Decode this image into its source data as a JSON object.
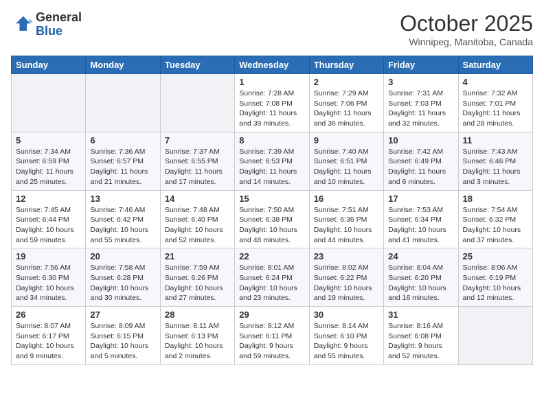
{
  "header": {
    "logo_general": "General",
    "logo_blue": "Blue",
    "month": "October 2025",
    "location": "Winnipeg, Manitoba, Canada"
  },
  "weekdays": [
    "Sunday",
    "Monday",
    "Tuesday",
    "Wednesday",
    "Thursday",
    "Friday",
    "Saturday"
  ],
  "weeks": [
    [
      {
        "day": "",
        "info": ""
      },
      {
        "day": "",
        "info": ""
      },
      {
        "day": "",
        "info": ""
      },
      {
        "day": "1",
        "info": "Sunrise: 7:28 AM\nSunset: 7:08 PM\nDaylight: 11 hours\nand 39 minutes."
      },
      {
        "day": "2",
        "info": "Sunrise: 7:29 AM\nSunset: 7:06 PM\nDaylight: 11 hours\nand 36 minutes."
      },
      {
        "day": "3",
        "info": "Sunrise: 7:31 AM\nSunset: 7:03 PM\nDaylight: 11 hours\nand 32 minutes."
      },
      {
        "day": "4",
        "info": "Sunrise: 7:32 AM\nSunset: 7:01 PM\nDaylight: 11 hours\nand 28 minutes."
      }
    ],
    [
      {
        "day": "5",
        "info": "Sunrise: 7:34 AM\nSunset: 6:59 PM\nDaylight: 11 hours\nand 25 minutes."
      },
      {
        "day": "6",
        "info": "Sunrise: 7:36 AM\nSunset: 6:57 PM\nDaylight: 11 hours\nand 21 minutes."
      },
      {
        "day": "7",
        "info": "Sunrise: 7:37 AM\nSunset: 6:55 PM\nDaylight: 11 hours\nand 17 minutes."
      },
      {
        "day": "8",
        "info": "Sunrise: 7:39 AM\nSunset: 6:53 PM\nDaylight: 11 hours\nand 14 minutes."
      },
      {
        "day": "9",
        "info": "Sunrise: 7:40 AM\nSunset: 6:51 PM\nDaylight: 11 hours\nand 10 minutes."
      },
      {
        "day": "10",
        "info": "Sunrise: 7:42 AM\nSunset: 6:49 PM\nDaylight: 11 hours\nand 6 minutes."
      },
      {
        "day": "11",
        "info": "Sunrise: 7:43 AM\nSunset: 6:46 PM\nDaylight: 11 hours\nand 3 minutes."
      }
    ],
    [
      {
        "day": "12",
        "info": "Sunrise: 7:45 AM\nSunset: 6:44 PM\nDaylight: 10 hours\nand 59 minutes."
      },
      {
        "day": "13",
        "info": "Sunrise: 7:46 AM\nSunset: 6:42 PM\nDaylight: 10 hours\nand 55 minutes."
      },
      {
        "day": "14",
        "info": "Sunrise: 7:48 AM\nSunset: 6:40 PM\nDaylight: 10 hours\nand 52 minutes."
      },
      {
        "day": "15",
        "info": "Sunrise: 7:50 AM\nSunset: 6:38 PM\nDaylight: 10 hours\nand 48 minutes."
      },
      {
        "day": "16",
        "info": "Sunrise: 7:51 AM\nSunset: 6:36 PM\nDaylight: 10 hours\nand 44 minutes."
      },
      {
        "day": "17",
        "info": "Sunrise: 7:53 AM\nSunset: 6:34 PM\nDaylight: 10 hours\nand 41 minutes."
      },
      {
        "day": "18",
        "info": "Sunrise: 7:54 AM\nSunset: 6:32 PM\nDaylight: 10 hours\nand 37 minutes."
      }
    ],
    [
      {
        "day": "19",
        "info": "Sunrise: 7:56 AM\nSunset: 6:30 PM\nDaylight: 10 hours\nand 34 minutes."
      },
      {
        "day": "20",
        "info": "Sunrise: 7:58 AM\nSunset: 6:28 PM\nDaylight: 10 hours\nand 30 minutes."
      },
      {
        "day": "21",
        "info": "Sunrise: 7:59 AM\nSunset: 6:26 PM\nDaylight: 10 hours\nand 27 minutes."
      },
      {
        "day": "22",
        "info": "Sunrise: 8:01 AM\nSunset: 6:24 PM\nDaylight: 10 hours\nand 23 minutes."
      },
      {
        "day": "23",
        "info": "Sunrise: 8:02 AM\nSunset: 6:22 PM\nDaylight: 10 hours\nand 19 minutes."
      },
      {
        "day": "24",
        "info": "Sunrise: 8:04 AM\nSunset: 6:20 PM\nDaylight: 10 hours\nand 16 minutes."
      },
      {
        "day": "25",
        "info": "Sunrise: 8:06 AM\nSunset: 6:19 PM\nDaylight: 10 hours\nand 12 minutes."
      }
    ],
    [
      {
        "day": "26",
        "info": "Sunrise: 8:07 AM\nSunset: 6:17 PM\nDaylight: 10 hours\nand 9 minutes."
      },
      {
        "day": "27",
        "info": "Sunrise: 8:09 AM\nSunset: 6:15 PM\nDaylight: 10 hours\nand 5 minutes."
      },
      {
        "day": "28",
        "info": "Sunrise: 8:11 AM\nSunset: 6:13 PM\nDaylight: 10 hours\nand 2 minutes."
      },
      {
        "day": "29",
        "info": "Sunrise: 8:12 AM\nSunset: 6:11 PM\nDaylight: 9 hours\nand 59 minutes."
      },
      {
        "day": "30",
        "info": "Sunrise: 8:14 AM\nSunset: 6:10 PM\nDaylight: 9 hours\nand 55 minutes."
      },
      {
        "day": "31",
        "info": "Sunrise: 8:16 AM\nSunset: 6:08 PM\nDaylight: 9 hours\nand 52 minutes."
      },
      {
        "day": "",
        "info": ""
      }
    ]
  ]
}
